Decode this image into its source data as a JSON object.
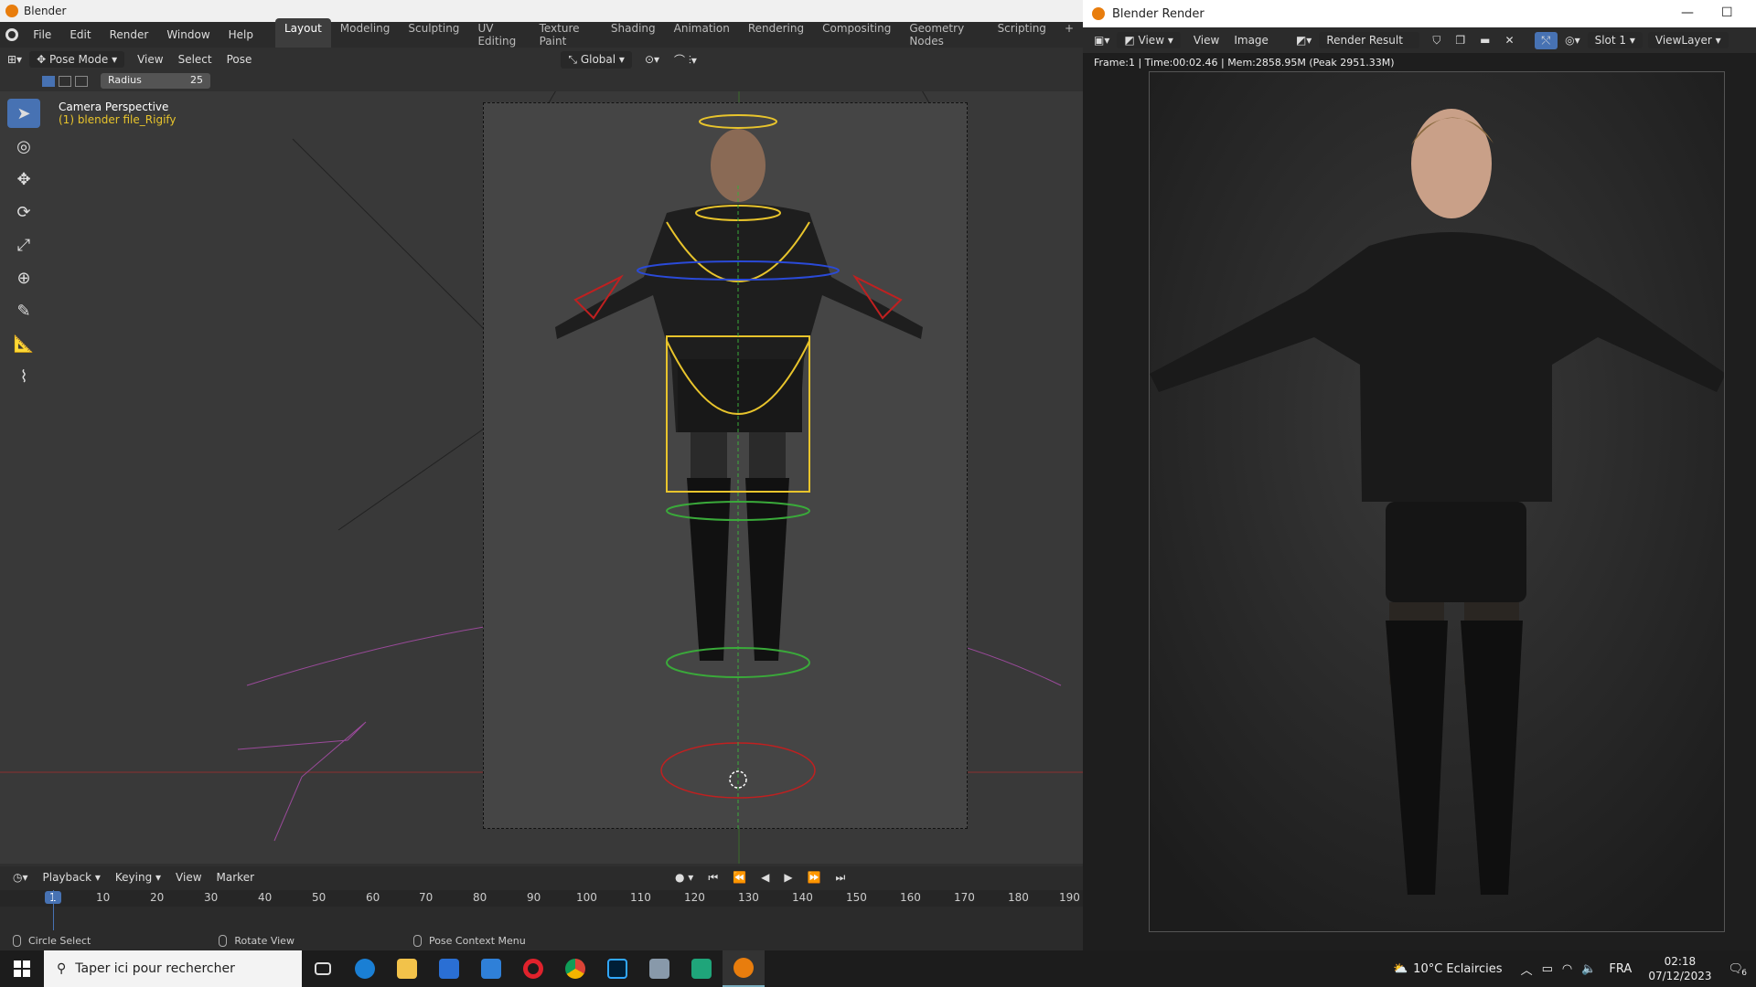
{
  "window": {
    "title": "Blender"
  },
  "menu": [
    "File",
    "Edit",
    "Render",
    "Window",
    "Help"
  ],
  "workspaces": [
    "Layout",
    "Modeling",
    "Sculpting",
    "UV Editing",
    "Texture Paint",
    "Shading",
    "Animation",
    "Rendering",
    "Compositing",
    "Geometry Nodes",
    "Scripting"
  ],
  "active_workspace": "Layout",
  "header": {
    "mode": "Pose Mode",
    "view": "View",
    "select": "Select",
    "pose": "Pose",
    "orientation": "Global"
  },
  "tool_settings": {
    "radius_label": "Radius",
    "radius_value": "25"
  },
  "viewport": {
    "line1": "Camera Perspective",
    "line2": "(1) blender file_Rigify"
  },
  "timeline": {
    "playback": "Playback",
    "keying": "Keying",
    "view": "View",
    "marker": "Marker",
    "current_frame": "1",
    "ticks": [
      "10",
      "20",
      "30",
      "40",
      "50",
      "60",
      "70",
      "80",
      "90",
      "100",
      "110",
      "120",
      "130",
      "140",
      "150",
      "160",
      "170",
      "180",
      "190"
    ]
  },
  "status": {
    "left": "Circle Select",
    "middle": "Rotate View",
    "right": "Pose Context Menu"
  },
  "render_window": {
    "title": "Blender Render",
    "view1": "View",
    "view2": "View",
    "image": "Image",
    "result": "Render Result",
    "slot": "Slot 1",
    "layer": "ViewLayer",
    "info": "Frame:1 | Time:00:02.46 | Mem:2858.95M (Peak 2951.33M)"
  },
  "taskbar": {
    "search_placeholder": "Taper ici pour rechercher",
    "weather": "10°C  Eclaircies",
    "lang": "FRA",
    "time": "02:18",
    "date": "07/12/2023",
    "notif": "6"
  },
  "colors": {
    "accent": "#4772b3",
    "blender_orange": "#e87d0d",
    "info_yellow": "#e8c42c"
  }
}
